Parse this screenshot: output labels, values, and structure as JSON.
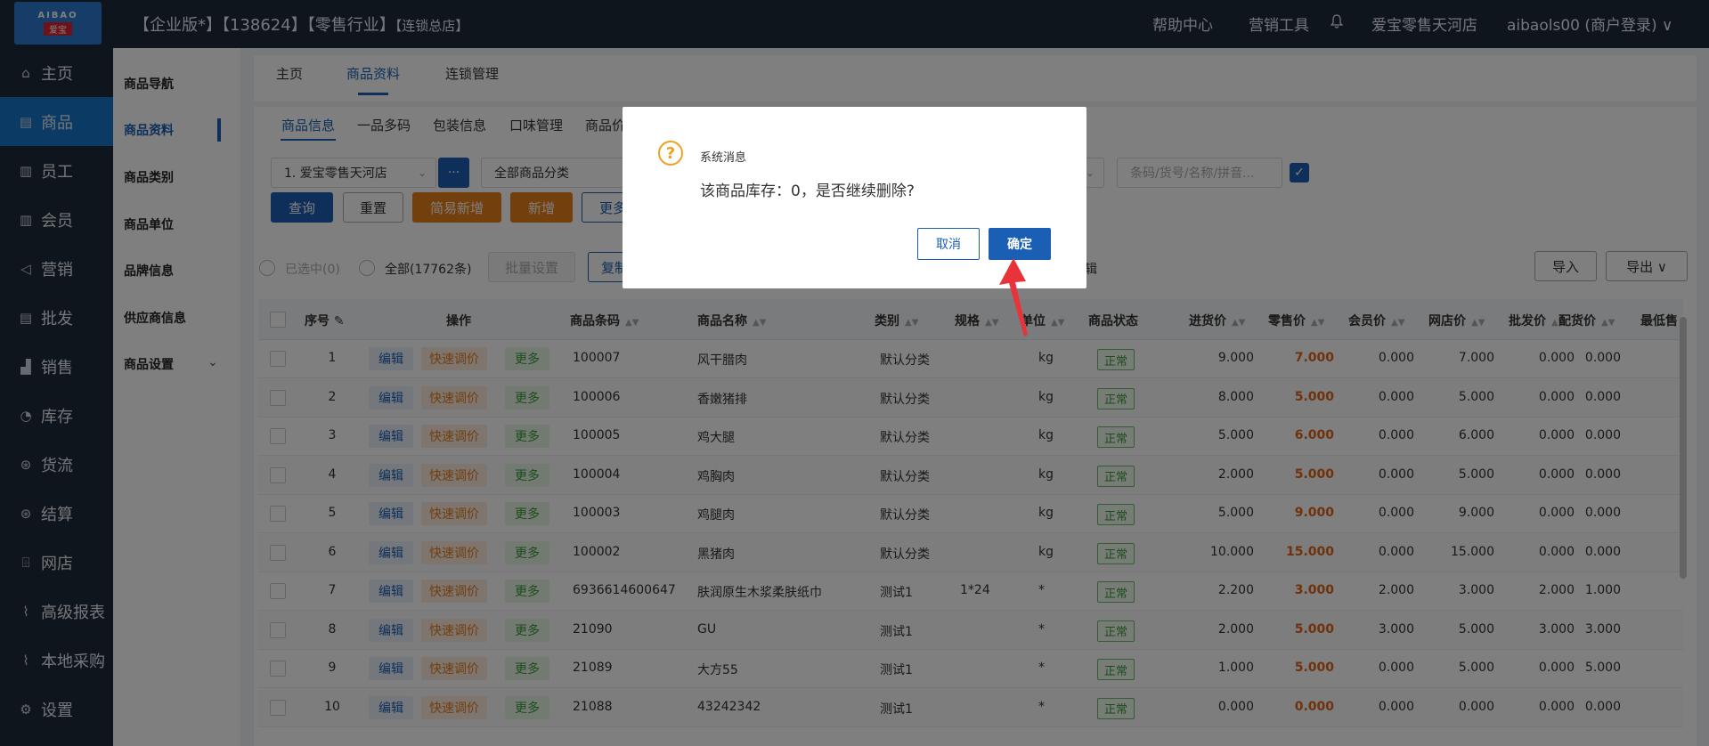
{
  "header": {
    "logo_top": "AIBAO",
    "logo_bottom": "爱宝",
    "title_main": "【企业版*】【138624】【零售行业】",
    "title_small": "【连锁总店】",
    "help": "帮助中心",
    "marketing_tools": "营销工具",
    "bell_icon": "bell-icon",
    "store": "爱宝零售天河店",
    "user": "aibaols00 (商户登录)",
    "user_chevron": "∨"
  },
  "sidebar": {
    "items": [
      {
        "icon": "⌂",
        "label": "主页"
      },
      {
        "icon": "▤",
        "label": "商品"
      },
      {
        "icon": "▥",
        "label": "员工"
      },
      {
        "icon": "▥",
        "label": "会员"
      },
      {
        "icon": "◁",
        "label": "营销"
      },
      {
        "icon": "▤",
        "label": "批发"
      },
      {
        "icon": "▟",
        "label": "销售"
      },
      {
        "icon": "◔",
        "label": "库存"
      },
      {
        "icon": "⊛",
        "label": "货流"
      },
      {
        "icon": "⊛",
        "label": "结算"
      },
      {
        "icon": "⌹",
        "label": "网店"
      },
      {
        "icon": "⌇",
        "label": "高级报表"
      },
      {
        "icon": "⌇",
        "label": "本地采购"
      },
      {
        "icon": "⚙",
        "label": "设置"
      }
    ]
  },
  "sub_sidebar": {
    "items": [
      "商品导航",
      "商品资料",
      "商品类别",
      "商品单位",
      "品牌信息",
      "供应商信息",
      "商品设置"
    ],
    "chevron": "⌄"
  },
  "top_tabs": [
    "主页",
    "商品资料",
    "连锁管理"
  ],
  "sub_tabs": [
    "商品信息",
    "一品多码",
    "包装信息",
    "口味管理",
    "商品价"
  ],
  "filters": {
    "store": "1. 爱宝零售天河店",
    "dots": "···",
    "category": "全部商品分类",
    "search_placeholder": "条码/货号/名称/拼音...",
    "check": "✓"
  },
  "buttons": {
    "query": "查询",
    "reset": "重置",
    "quick_add": "简易新增",
    "add": "新增",
    "more": "更多",
    "import": "导入",
    "export": "导出 ∨"
  },
  "selection": {
    "selected": "已选中(0)",
    "all": "全部(17762条)",
    "batch": "批量设置",
    "copy": "复制",
    "edit_tail": "辑"
  },
  "table": {
    "headers": [
      "序号",
      "操作",
      "商品条码",
      "商品名称",
      "类别",
      "规格",
      "单位",
      "商品状态",
      "进货价",
      "零售价",
      "会员价",
      "网店价",
      "批发价",
      "配货价",
      "最低售"
    ],
    "op_labels": {
      "edit": "编辑",
      "quick": "快速调价",
      "more": "更多"
    },
    "status_label": "正常",
    "rows": [
      {
        "no": "1",
        "barcode": "100007",
        "name": "风干腊肉",
        "cat": "默认分类",
        "spec": "",
        "unit": "kg",
        "buy": "9.000",
        "retail": "7.000",
        "member": "0.000",
        "online": "7.000",
        "wholesale": "0.000",
        "dist": "0.000"
      },
      {
        "no": "2",
        "barcode": "100006",
        "name": "香嫩猪排",
        "cat": "默认分类",
        "spec": "",
        "unit": "kg",
        "buy": "8.000",
        "retail": "5.000",
        "member": "0.000",
        "online": "5.000",
        "wholesale": "0.000",
        "dist": "0.000"
      },
      {
        "no": "3",
        "barcode": "100005",
        "name": "鸡大腿",
        "cat": "默认分类",
        "spec": "",
        "unit": "kg",
        "buy": "5.000",
        "retail": "6.000",
        "member": "0.000",
        "online": "6.000",
        "wholesale": "0.000",
        "dist": "0.000"
      },
      {
        "no": "4",
        "barcode": "100004",
        "name": "鸡胸肉",
        "cat": "默认分类",
        "spec": "",
        "unit": "kg",
        "buy": "2.000",
        "retail": "5.000",
        "member": "0.000",
        "online": "5.000",
        "wholesale": "0.000",
        "dist": "0.000"
      },
      {
        "no": "5",
        "barcode": "100003",
        "name": "鸡腿肉",
        "cat": "默认分类",
        "spec": "",
        "unit": "kg",
        "buy": "5.000",
        "retail": "9.000",
        "member": "0.000",
        "online": "9.000",
        "wholesale": "0.000",
        "dist": "0.000"
      },
      {
        "no": "6",
        "barcode": "100002",
        "name": "黑猪肉",
        "cat": "默认分类",
        "spec": "",
        "unit": "kg",
        "buy": "10.000",
        "retail": "15.000",
        "member": "0.000",
        "online": "15.000",
        "wholesale": "0.000",
        "dist": "0.000"
      },
      {
        "no": "7",
        "barcode": "6936614600647",
        "name": "肤润原生木浆柔肤纸巾",
        "cat": "测试1",
        "spec": "1*24",
        "unit": "*",
        "buy": "2.200",
        "retail": "3.000",
        "member": "2.000",
        "online": "3.000",
        "wholesale": "2.000",
        "dist": "1.000"
      },
      {
        "no": "8",
        "barcode": "21090",
        "name": "GU",
        "cat": "测试1",
        "spec": "",
        "unit": "*",
        "buy": "2.000",
        "retail": "5.000",
        "member": "3.000",
        "online": "5.000",
        "wholesale": "3.000",
        "dist": "3.000"
      },
      {
        "no": "9",
        "barcode": "21089",
        "name": "大方55",
        "cat": "测试1",
        "spec": "",
        "unit": "*",
        "buy": "1.000",
        "retail": "5.000",
        "member": "0.000",
        "online": "5.000",
        "wholesale": "0.000",
        "dist": "5.000"
      },
      {
        "no": "10",
        "barcode": "21088",
        "name": "43242342",
        "cat": "测试1",
        "spec": "",
        "unit": "*",
        "buy": "0.000",
        "retail": "0.000",
        "member": "0.000",
        "online": "0.000",
        "wholesale": "0.000",
        "dist": "0.000"
      }
    ]
  },
  "dialog": {
    "icon": "?",
    "title": "系统消息",
    "message": "该商品库存：0，是否继续删除?",
    "cancel": "取消",
    "ok": "确定"
  },
  "colors": {
    "header_bg": "#1f2a3a",
    "accent": "#1a5fb4",
    "orange": "#e57e1a",
    "arrow": "#e8333a"
  }
}
